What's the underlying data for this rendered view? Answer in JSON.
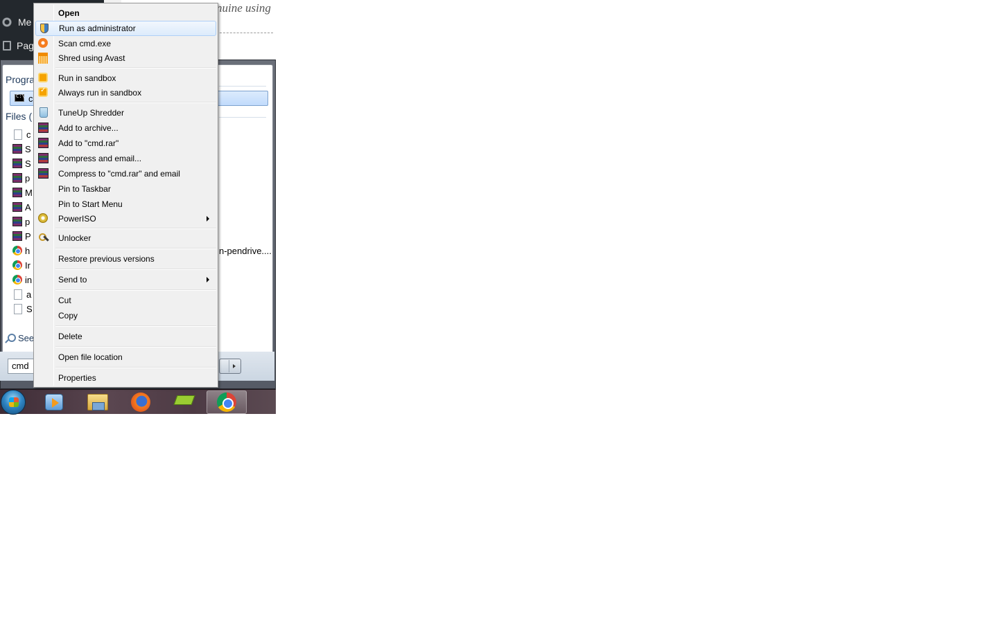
{
  "background": {
    "admin_menu": [
      {
        "label": "Me",
        "icon": "settings-icon"
      },
      {
        "label": "Pag",
        "icon": "pages-icon"
      }
    ],
    "article_fragment": "nuine using"
  },
  "start_menu": {
    "programs_heading": "Progra",
    "program_item": "cr",
    "files_heading": "Files (",
    "files": [
      {
        "label": "c",
        "icon": "document-icon"
      },
      {
        "label": "S",
        "icon": "winrar-icon"
      },
      {
        "label": "S",
        "icon": "winrar-icon"
      },
      {
        "label": "p",
        "icon": "winrar-icon"
      },
      {
        "label": "M",
        "icon": "winrar-icon"
      },
      {
        "label": "A",
        "icon": "winrar-icon"
      },
      {
        "label": "p",
        "icon": "winrar-icon"
      },
      {
        "label": "P",
        "icon": "winrar-icon"
      },
      {
        "label": "h",
        "icon": "chrome-icon"
      },
      {
        "label": "Ir",
        "icon": "chrome-icon"
      },
      {
        "label": "in",
        "icon": "chrome-icon"
      },
      {
        "label": "a",
        "icon": "document-icon"
      },
      {
        "label": "S",
        "icon": "document-icon"
      }
    ],
    "right_fragment": "n-pendrive....",
    "see_more": "See",
    "search_value": "cmd"
  },
  "context_menu": {
    "items": [
      {
        "label": "Open",
        "bold": true,
        "icon": ""
      },
      {
        "label": "Run as administrator",
        "icon": "uac-shield-icon",
        "highlighted": true
      },
      {
        "label": "Scan cmd.exe",
        "icon": "avast-icon"
      },
      {
        "label": "Shred using Avast",
        "icon": "avast-shredder-icon"
      },
      {
        "label": "Run in sandbox",
        "icon": "sandbox-icon"
      },
      {
        "label": "Always run in sandbox",
        "icon": "sandbox-check-icon"
      },
      {
        "label": "TuneUp Shredder",
        "icon": "shredder-bin-icon"
      },
      {
        "label": "Add to archive...",
        "icon": "winrar-icon"
      },
      {
        "label": "Add to \"cmd.rar\"",
        "icon": "winrar-icon"
      },
      {
        "label": "Compress and email...",
        "icon": "winrar-icon"
      },
      {
        "label": "Compress to \"cmd.rar\" and email",
        "icon": "winrar-icon"
      },
      {
        "label": "Pin to Taskbar",
        "icon": ""
      },
      {
        "label": "Pin to Start Menu",
        "icon": ""
      },
      {
        "label": "PowerISO",
        "icon": "poweriso-icon",
        "submenu": true
      },
      {
        "label": "Unlocker",
        "icon": "unlocker-icon"
      },
      {
        "label": "Restore previous versions",
        "icon": ""
      },
      {
        "label": "Send to",
        "icon": "",
        "submenu": true
      },
      {
        "label": "Cut",
        "icon": ""
      },
      {
        "label": "Copy",
        "icon": ""
      },
      {
        "label": "Delete",
        "icon": ""
      },
      {
        "label": "Open file location",
        "icon": ""
      },
      {
        "label": "Properties",
        "icon": ""
      }
    ]
  },
  "taskbar": {
    "items": [
      "start-orb-icon",
      "media-player-icon",
      "file-explorer-icon",
      "firefox-icon",
      "bluestacks-icon",
      "chrome-icon"
    ],
    "active": "chrome-icon"
  }
}
